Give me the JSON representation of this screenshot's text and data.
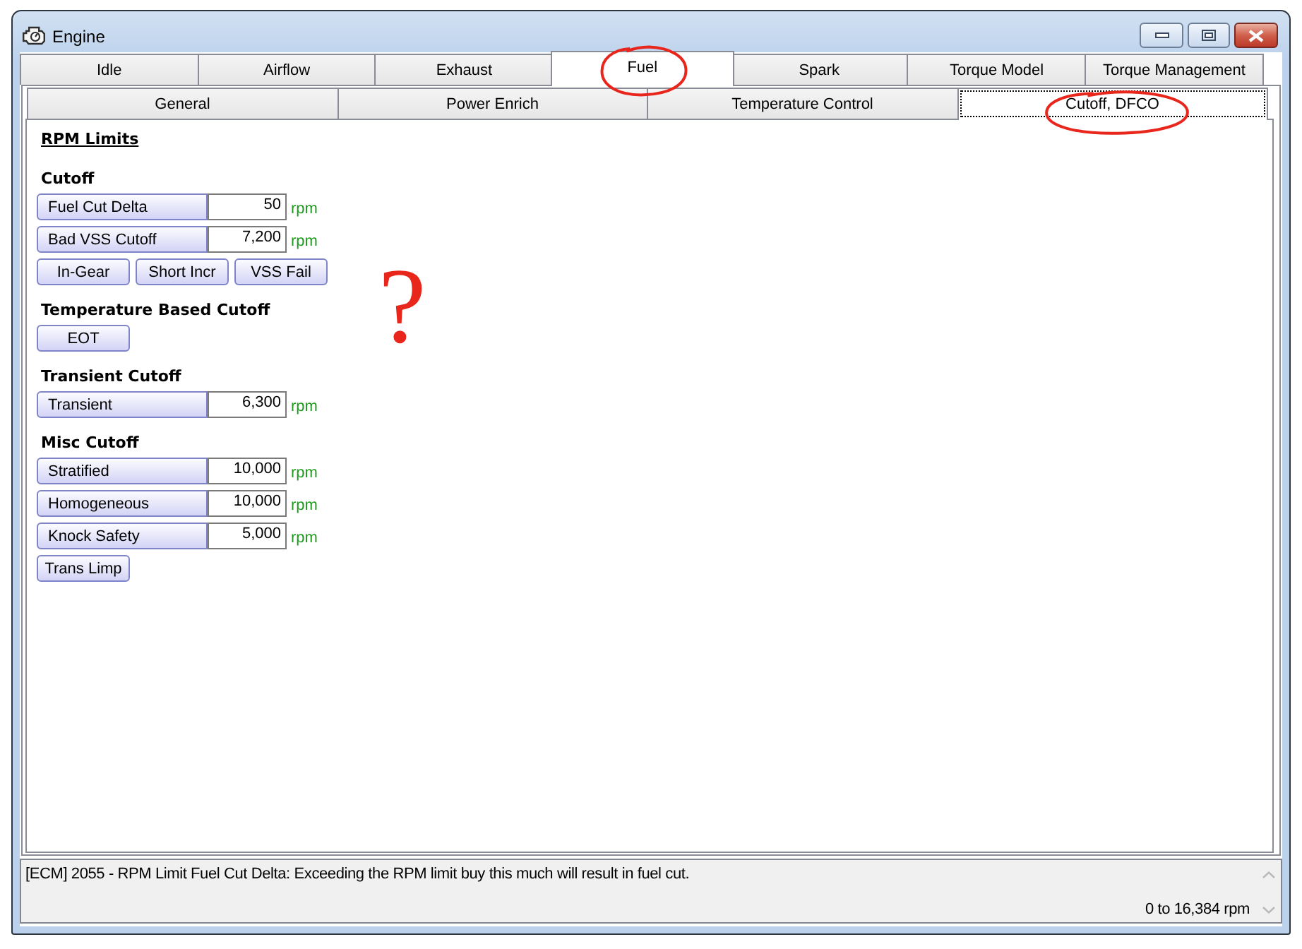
{
  "window": {
    "title": "Engine"
  },
  "tabs": [
    {
      "label": "Idle",
      "selected": false,
      "circled": false
    },
    {
      "label": "Airflow",
      "selected": false,
      "circled": false
    },
    {
      "label": "Exhaust",
      "selected": false,
      "circled": false
    },
    {
      "label": "Fuel",
      "selected": true,
      "circled": true
    },
    {
      "label": "Spark",
      "selected": false,
      "circled": false
    },
    {
      "label": "Torque Model",
      "selected": false,
      "circled": false
    },
    {
      "label": "Torque Management",
      "selected": false,
      "circled": false
    }
  ],
  "subtabs": [
    {
      "label": "General",
      "selected": false,
      "circled": false
    },
    {
      "label": "Power Enrich",
      "selected": false,
      "circled": false
    },
    {
      "label": "Temperature Control",
      "selected": false,
      "circled": false
    },
    {
      "label": "Cutoff, DFCO",
      "selected": true,
      "circled": true
    }
  ],
  "section_title": "RPM Limits",
  "groups": [
    {
      "heading": "Cutoff",
      "items": [
        {
          "kind": "field",
          "label": "Fuel Cut Delta",
          "value": "50",
          "unit": "rpm"
        },
        {
          "kind": "field",
          "label": "Bad VSS Cutoff",
          "value": "7,200",
          "unit": "rpm"
        },
        {
          "kind": "buttons",
          "buttons": [
            "In-Gear",
            "Short Incr",
            "VSS Fail"
          ]
        }
      ]
    },
    {
      "heading": "Temperature Based Cutoff",
      "items": [
        {
          "kind": "buttons",
          "buttons": [
            "EOT"
          ]
        }
      ]
    },
    {
      "heading": "Transient Cutoff",
      "items": [
        {
          "kind": "field",
          "label": "Transient",
          "value": "6,300",
          "unit": "rpm"
        }
      ]
    },
    {
      "heading": "Misc Cutoff",
      "items": [
        {
          "kind": "field",
          "label": "Stratified",
          "value": "10,000",
          "unit": "rpm"
        },
        {
          "kind": "field",
          "label": "Homogeneous",
          "value": "10,000",
          "unit": "rpm"
        },
        {
          "kind": "field",
          "label": "Knock Safety",
          "value": "5,000",
          "unit": "rpm"
        },
        {
          "kind": "buttons",
          "buttons": [
            "Trans Limp"
          ]
        }
      ]
    }
  ],
  "annotation_mark": "?",
  "status": {
    "message": "[ECM] 2055 - RPM Limit Fuel Cut Delta: Exceeding the RPM limit buy this much will result in fuel cut.",
    "range": "0 to 16,384 rpm"
  }
}
